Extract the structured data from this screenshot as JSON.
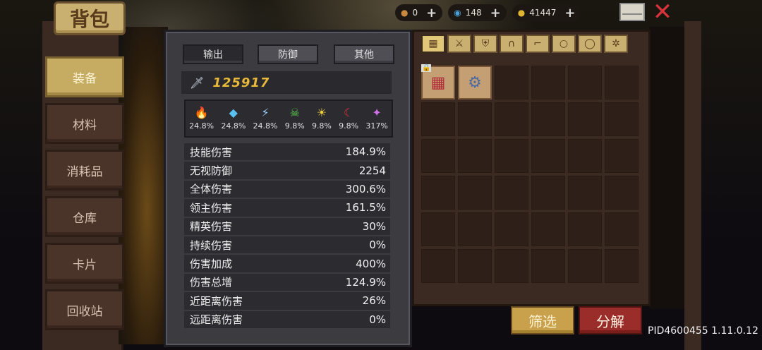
{
  "header": {
    "bag_title": "背包"
  },
  "resources": [
    {
      "icon": "bone-icon",
      "value": "0"
    },
    {
      "icon": "gem-icon",
      "value": "148"
    },
    {
      "icon": "coin-icon",
      "value": "41447"
    }
  ],
  "sidebar": {
    "items": [
      {
        "label": "装备",
        "active": true
      },
      {
        "label": "材料"
      },
      {
        "label": "消耗品"
      },
      {
        "label": "仓库"
      },
      {
        "label": "卡片"
      },
      {
        "label": "回收站"
      }
    ]
  },
  "stats_panel": {
    "tabs": [
      "输出",
      "防御",
      "其他"
    ],
    "power": "125917",
    "elements": [
      {
        "icon": "fire-icon",
        "glyph": "🔥",
        "value": "24.8%"
      },
      {
        "icon": "ice-icon",
        "glyph": "◆",
        "value": "24.8%"
      },
      {
        "icon": "lightning-icon",
        "glyph": "⚡",
        "value": "24.8%"
      },
      {
        "icon": "poison-skull-icon",
        "glyph": "☠",
        "value": "9.8%"
      },
      {
        "icon": "sun-icon",
        "glyph": "☀",
        "value": "9.8%"
      },
      {
        "icon": "moon-icon",
        "glyph": "☾",
        "value": "9.8%"
      },
      {
        "icon": "arcane-star-icon",
        "glyph": "✦",
        "value": "317%"
      }
    ],
    "rows": [
      {
        "label": "技能伤害",
        "value": "184.9%"
      },
      {
        "label": "无视防御",
        "value": "2254"
      },
      {
        "label": "全体伤害",
        "value": "300.6%"
      },
      {
        "label": "领主伤害",
        "value": "161.5%"
      },
      {
        "label": "精英伤害",
        "value": "30%"
      },
      {
        "label": "持续伤害",
        "value": "0%"
      },
      {
        "label": "伤害加成",
        "value": "400%"
      },
      {
        "label": "伤害总增",
        "value": "124.9%"
      },
      {
        "label": "近距离伤害",
        "value": "26%"
      },
      {
        "label": "远距离伤害",
        "value": "0%"
      }
    ]
  },
  "inventory": {
    "categories": [
      "grid-icon",
      "sword-icon",
      "armor-icon",
      "helmet-icon",
      "boots-icon",
      "ring-icon",
      "amulet-icon",
      "gear-icon"
    ],
    "items": [
      {
        "icon": "locked-basket-item-icon",
        "glyph": "▦",
        "locked": true
      },
      {
        "icon": "gear-item-icon",
        "glyph": "⚙",
        "locked": false
      }
    ]
  },
  "actions": {
    "filter": "筛选",
    "decompose": "分解"
  },
  "footer": {
    "pid": "PID4600455 1.11.0.12"
  }
}
